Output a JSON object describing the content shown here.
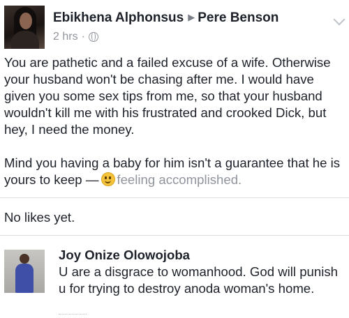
{
  "post": {
    "author": "Ebikhena Alphonsus",
    "target": "Pere Benson",
    "time": "2 hrs",
    "separator": "·",
    "paragraph1": "You are pathetic and a failed excuse of a wife. Otherwise your husband won't be chasing after me. I would have given you  some sex tips from me, so that your husband wouldn't kill me with his frustrated and crooked Dick, but hey, I need the money.",
    "paragraph2": "Mind you having a baby for him isn't a guarantee that he is yours to keep",
    "feeling_dash": "—",
    "feeling": "feeling accomplished."
  },
  "likes": {
    "text": "No likes yet."
  },
  "comment": {
    "author": "Joy Onize Olowojoba",
    "text": "U are a disgrace to womanhood. God will punish u for trying to destroy anoda woman's home."
  },
  "icons": [
    "arrow-right-icon",
    "globe-icon",
    "chevron-down-icon",
    "emoji-icon"
  ]
}
